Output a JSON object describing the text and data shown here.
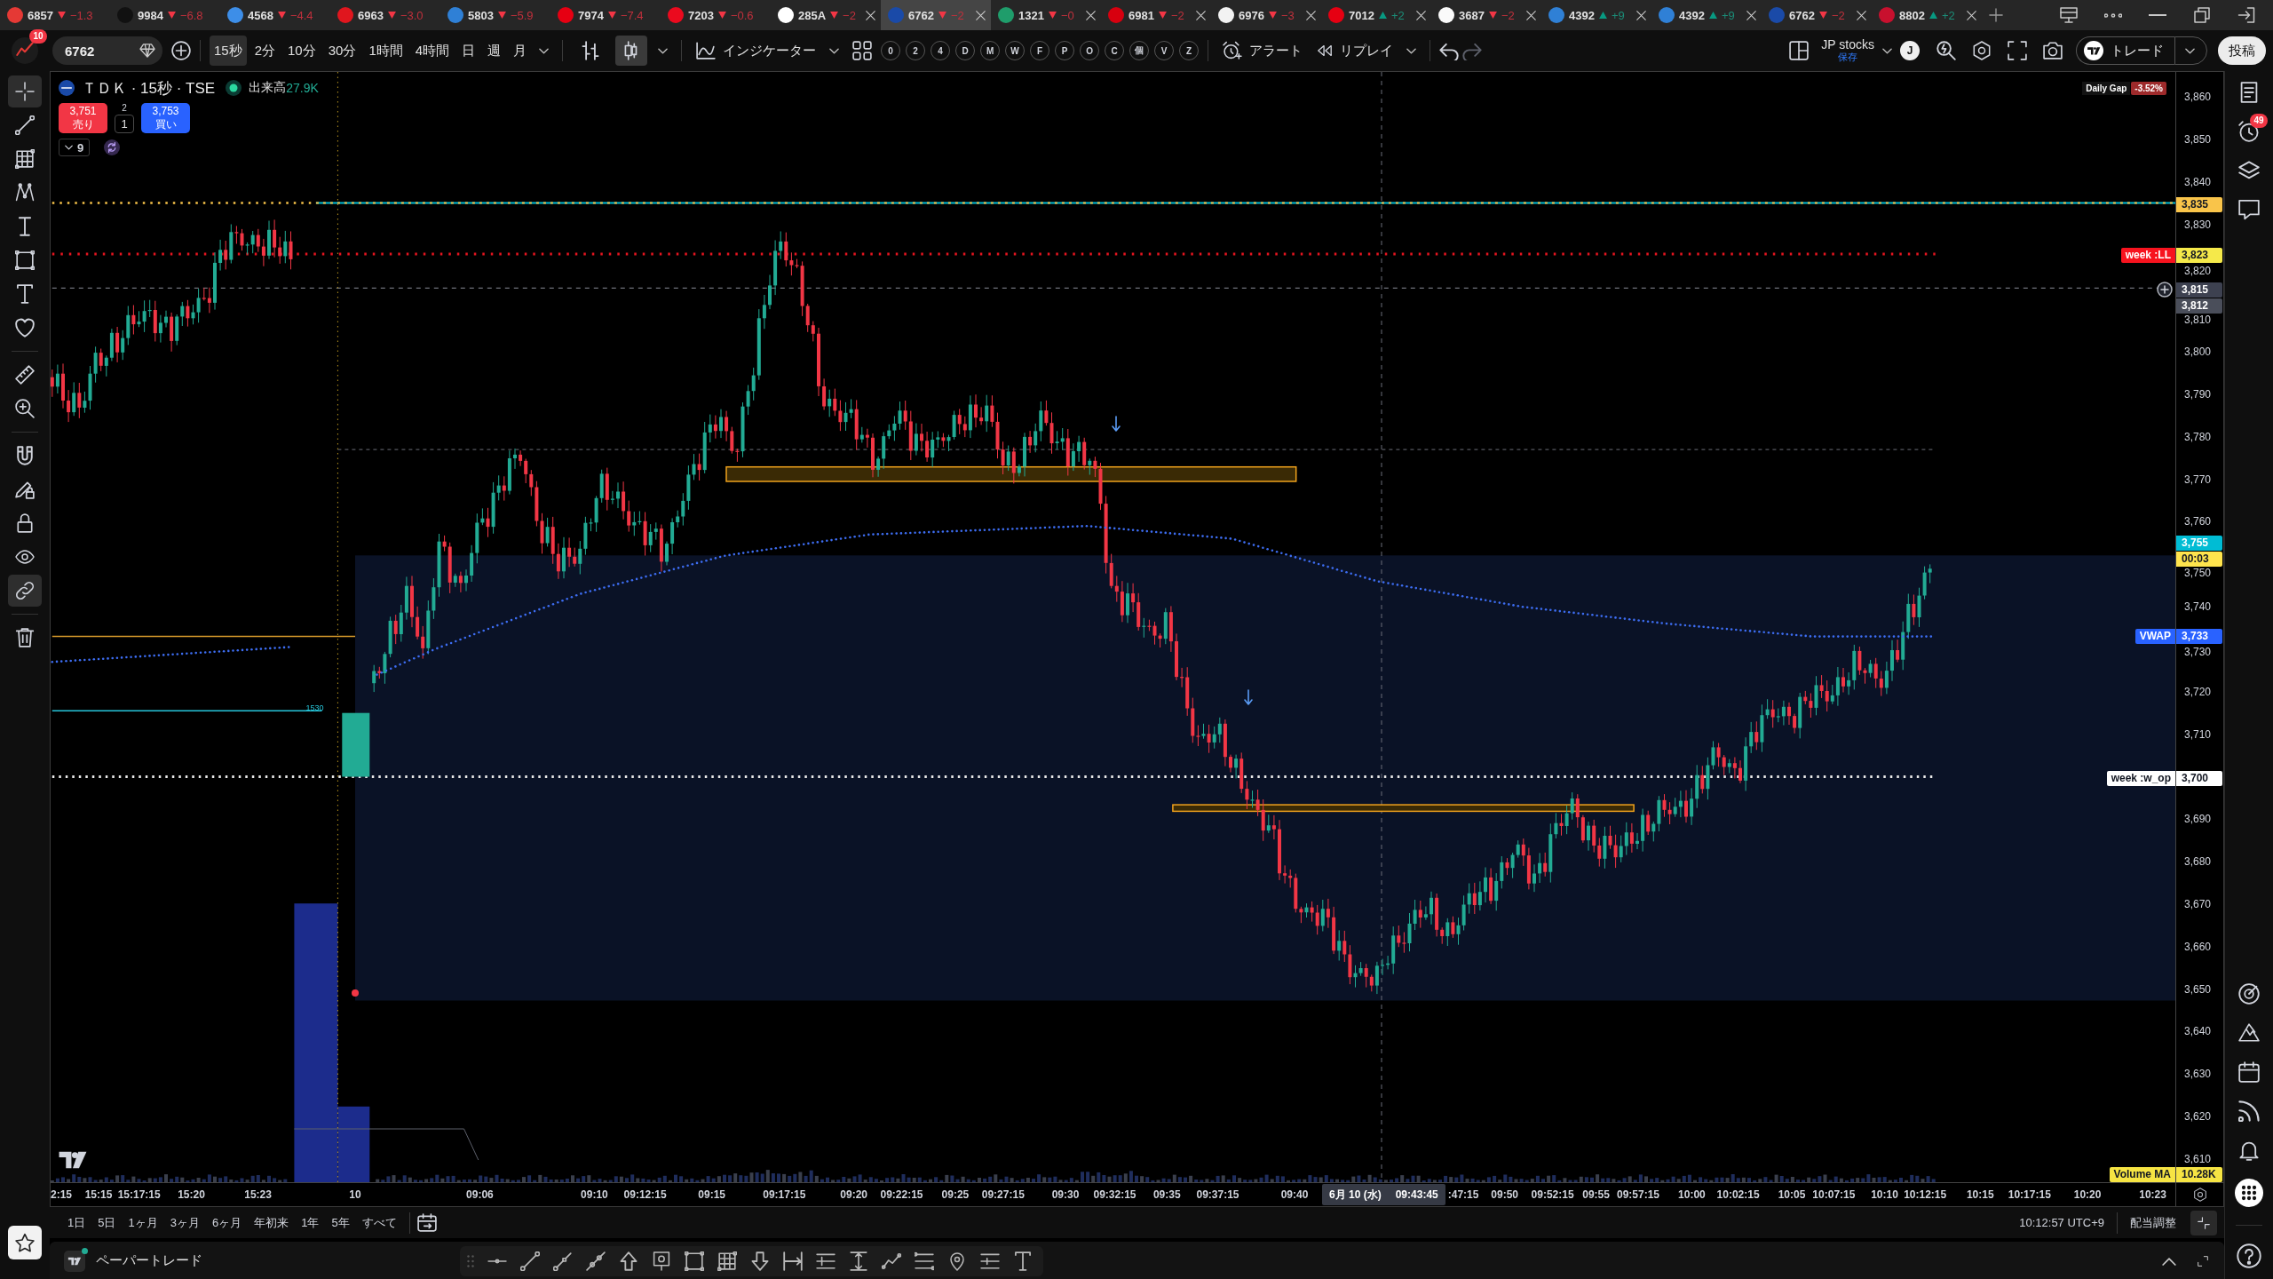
{
  "tabs": [
    {
      "code": "6857",
      "color": "#e53935",
      "rising": false,
      "change": "−1.3",
      "closable": false,
      "selected": false
    },
    {
      "code": "9984",
      "color": "#111111",
      "rising": false,
      "change": "−6.8",
      "closable": false,
      "selected": false
    },
    {
      "code": "4568",
      "color": "#3d8ee8",
      "rising": false,
      "change": "−4.4",
      "closable": false,
      "selected": false
    },
    {
      "code": "6963",
      "color": "#e0161e",
      "rising": false,
      "change": "−3.0",
      "closable": false,
      "selected": false
    },
    {
      "code": "5803",
      "color": "#2f80d6",
      "rising": false,
      "change": "−5.9",
      "closable": false,
      "selected": false
    },
    {
      "code": "7974",
      "color": "#e60012",
      "rising": false,
      "change": "−7.4",
      "closable": false,
      "selected": false
    },
    {
      "code": "7203",
      "color": "#eb0a1e",
      "rising": false,
      "change": "−0.6",
      "closable": false,
      "selected": false
    },
    {
      "code": "285A",
      "color": "#ffffff",
      "rising": false,
      "change": "−2",
      "closable": true,
      "selected": false
    },
    {
      "code": "6762",
      "color": "#1a4aa8",
      "rising": false,
      "change": "−2",
      "closable": true,
      "selected": true
    },
    {
      "code": "1321",
      "color": "#1f9d6b",
      "rising": false,
      "change": "−0",
      "closable": true,
      "selected": false
    },
    {
      "code": "6981",
      "color": "#d7000f",
      "rising": false,
      "change": "−2",
      "closable": true,
      "selected": false
    },
    {
      "code": "6976",
      "color": "#f2f2f2",
      "rising": false,
      "change": "−3",
      "closable": true,
      "selected": false
    },
    {
      "code": "7012",
      "color": "#e60012",
      "rising": true,
      "change": "+2",
      "closable": true,
      "selected": false
    },
    {
      "code": "3687",
      "color": "#fafafa",
      "rising": false,
      "change": "−2",
      "closable": true,
      "selected": false
    },
    {
      "code": "4392",
      "color": "#2f80d6",
      "rising": true,
      "change": "+9",
      "closable": true,
      "selected": false
    },
    {
      "code": "4392",
      "color": "#2f80d6",
      "rising": true,
      "change": "+9",
      "closable": true,
      "selected": false
    },
    {
      "code": "6762",
      "color": "#1a4aa8",
      "rising": false,
      "change": "−2",
      "closable": true,
      "selected": false
    },
    {
      "code": "8802",
      "color": "#c8102e",
      "rising": true,
      "change": "+2",
      "closable": true,
      "selected": false
    }
  ],
  "toolbar": {
    "avatar_badge": "10",
    "symbol": "6762",
    "intervals": [
      {
        "label": "15秒",
        "selected": true
      },
      {
        "label": "2分",
        "selected": false
      },
      {
        "label": "10分",
        "selected": false
      },
      {
        "label": "30分",
        "selected": false
      },
      {
        "label": "1時間",
        "selected": false
      },
      {
        "label": "4時間",
        "selected": false
      },
      {
        "label": "日",
        "selected": false
      },
      {
        "label": "週",
        "selected": false
      },
      {
        "label": "月",
        "selected": false
      }
    ],
    "chart_styles": [
      {
        "kind": "bars",
        "selected": false
      },
      {
        "kind": "candles",
        "selected": true
      }
    ],
    "indicators": "インジケーター",
    "hotkeys": [
      "0",
      "2",
      "4",
      "D",
      "M",
      "W",
      "F",
      "P",
      "O",
      "C",
      "個",
      "V",
      "Z"
    ],
    "alert": "アラート",
    "replay": "リプレイ",
    "layout": {
      "name": "JP stocks",
      "status": "保存"
    },
    "user_initial": "J",
    "trade": "トレード",
    "publish": "投稿"
  },
  "left_tools": [
    {
      "kind": "crosshair",
      "selected": true
    },
    {
      "kind": "trend-line",
      "selected": false
    },
    {
      "kind": "fib",
      "selected": false
    },
    {
      "kind": "pattern",
      "selected": false
    },
    {
      "kind": "anchored-text",
      "selected": false
    },
    {
      "kind": "shape",
      "selected": false
    },
    {
      "kind": "text",
      "selected": false
    },
    {
      "kind": "favorite",
      "selected": false
    },
    {
      "kind": "ruler",
      "selected": false
    },
    {
      "kind": "zoom",
      "selected": false
    },
    {
      "kind": "magnet",
      "selected": false
    },
    {
      "kind": "draw-lock",
      "selected": false
    },
    {
      "kind": "lock",
      "selected": false
    },
    {
      "kind": "visibility",
      "selected": false
    },
    {
      "kind": "sync",
      "selected": true
    },
    {
      "kind": "trash",
      "selected": false
    }
  ],
  "legend": {
    "title": "ＴＤＫ · 15秒 · TSE",
    "volume_label": "出来高",
    "volume": "27.9K",
    "sell": {
      "price": "3,751",
      "label": "売り"
    },
    "spread": "2",
    "quantity": "1",
    "buy": {
      "price": "3,753",
      "label": "買い"
    },
    "hidden_count": "9"
  },
  "chart": {
    "daily_gap": {
      "label": "Daily Gap",
      "value": "-3.52%"
    },
    "price_labels": [
      "3,860",
      "3,850",
      "3,840",
      "3,830",
      "3,820",
      "3,810",
      "3,800",
      "3,790",
      "3,780",
      "3,770",
      "3,760",
      "3,750",
      "3,740",
      "3,730",
      "3,720",
      "3,710",
      "3,690",
      "3,680",
      "3,670",
      "3,660",
      "3,650",
      "3,640",
      "3,630",
      "3,620",
      "3,610"
    ],
    "price_tags": [
      {
        "kind": "level",
        "text": "3,835",
        "color": "#f9c44a"
      },
      {
        "kind": "level",
        "text": "3,823",
        "color": "#f5e94a",
        "label": {
          "text": "week :LL",
          "color": "#f7131e"
        }
      },
      {
        "kind": "crosshair",
        "text": "3,815",
        "color": "#3d4150"
      },
      {
        "kind": "level",
        "text": "3,812",
        "color": "#4a4e5a"
      },
      {
        "kind": "level",
        "text": "3,755",
        "color": "#00bcd4"
      },
      {
        "kind": "level",
        "text": "00:03",
        "color": "#ffe44d"
      },
      {
        "kind": "level",
        "text": "3,733",
        "color": "#2962ff",
        "label": {
          "text": "VWAP",
          "color": "#2962ff"
        }
      },
      {
        "kind": "level",
        "text": "3,700",
        "color": "#ffffff",
        "label": {
          "text": "week :w_op",
          "color": "#ffffff"
        }
      },
      {
        "kind": "level",
        "text": "10.28K",
        "color": "#f6e443",
        "label": {
          "text": "Volume MA",
          "color": "#f6e443"
        }
      }
    ],
    "pane_label": "1530",
    "time_labels": [
      "2:15",
      "15:15",
      "15:17:15",
      "15:20",
      "15:23",
      "10",
      "09:06",
      "09:10",
      "09:12:15",
      "09:15",
      "09:17:15",
      "09:20",
      "09:22:15",
      "09:25",
      "09:27:15",
      "09:30",
      "09:32:15",
      "09:35",
      "09:37:15",
      "09:40",
      ":47:15",
      "09:50",
      "09:52:15",
      "09:55",
      "09:57:15",
      "10:00",
      "10:02:15",
      "10:05",
      "10:07:15",
      "10:10",
      "10:12:15",
      "10:15",
      "10:17:15",
      "10:20",
      "10:23"
    ],
    "crosshair": {
      "date": "6月 10 (水)",
      "time": "09:43:45"
    }
  },
  "range_bar": {
    "ranges": [
      "1日",
      "5日",
      "1ヶ月",
      "3ヶ月",
      "6ヶ月",
      "年初来",
      "1年",
      "5年",
      "すべて"
    ],
    "clock": "10:12:57 UTC+9",
    "adjustment": "配当調整"
  },
  "right_tools": {
    "alerts_badge": "49"
  },
  "bottom_panel": {
    "title": "ペーパートレード"
  }
}
